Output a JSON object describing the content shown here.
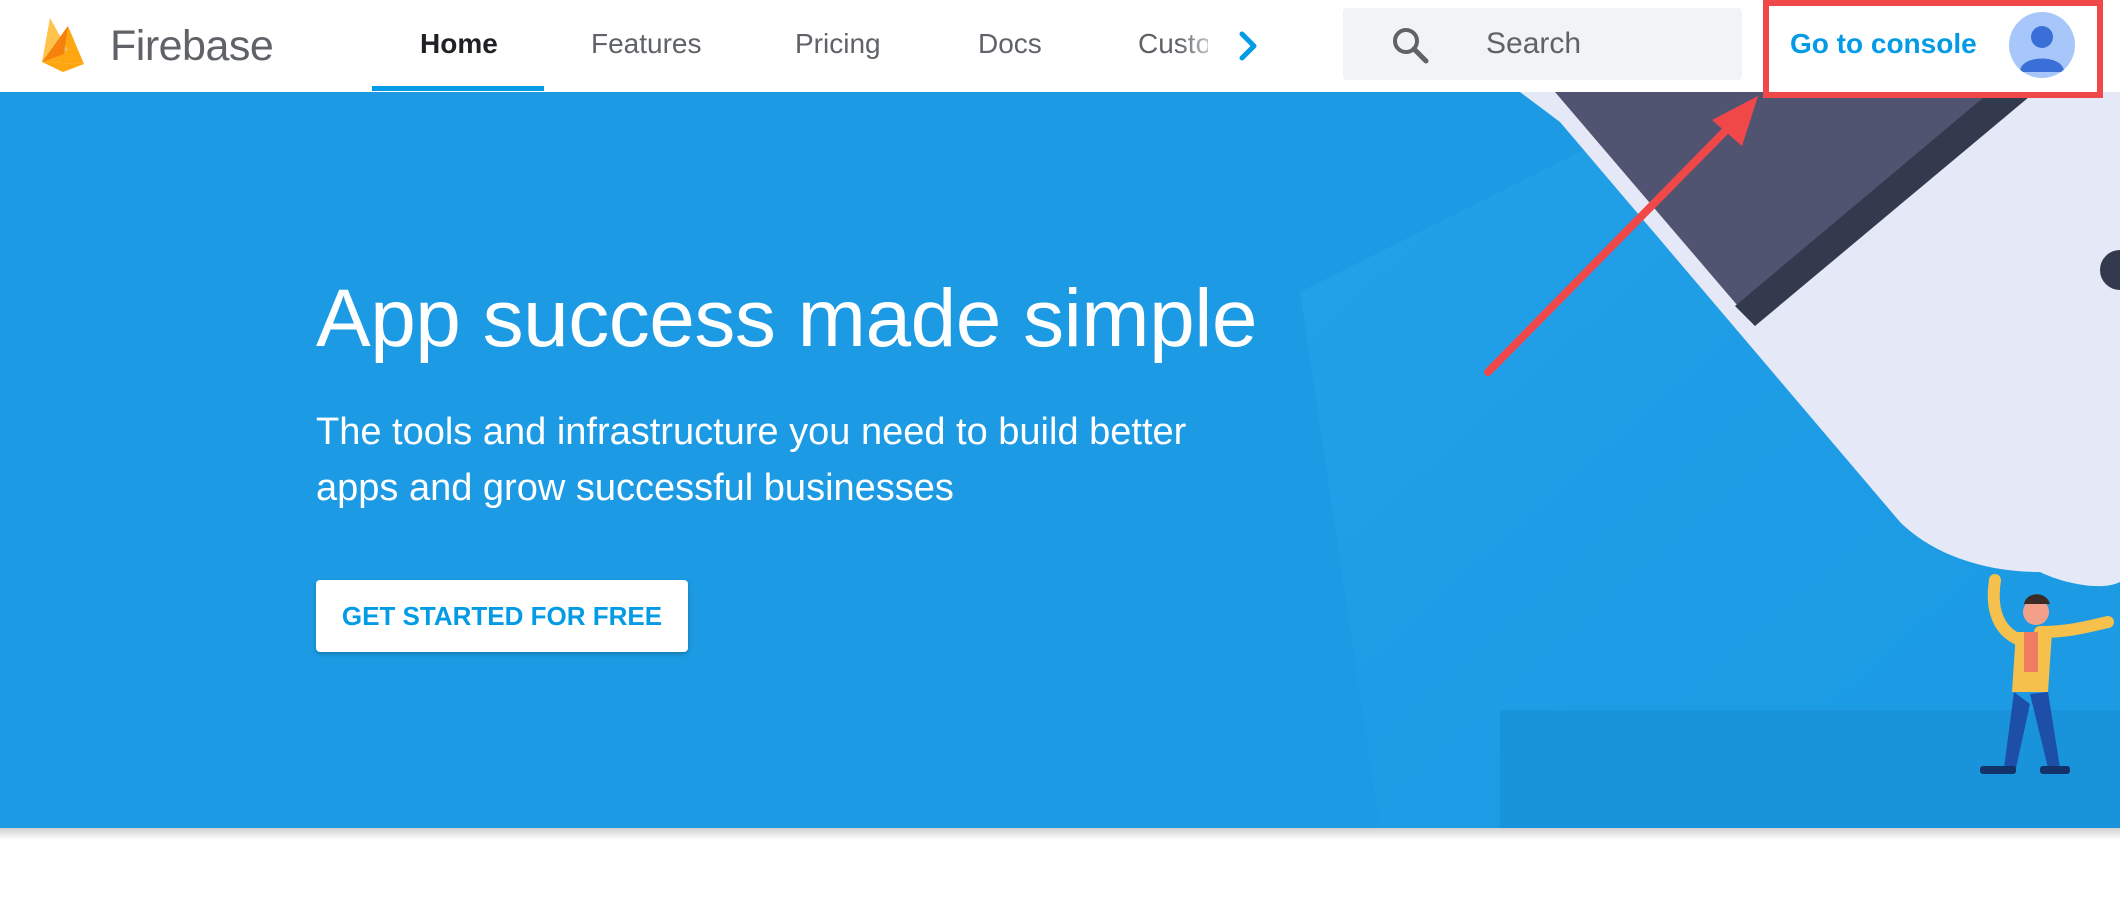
{
  "header": {
    "brand": "Firebase",
    "tabs": [
      {
        "label": "Home",
        "active": true
      },
      {
        "label": "Features",
        "active": false
      },
      {
        "label": "Pricing",
        "active": false
      },
      {
        "label": "Docs",
        "active": false
      },
      {
        "label": "Customers",
        "active": false
      }
    ],
    "search": {
      "placeholder": "Search"
    },
    "console_link": "Go to console",
    "icons": {
      "search": "search-icon",
      "more_tabs": "chevron-right-icon",
      "account": "avatar"
    }
  },
  "hero": {
    "headline": "App success made simple",
    "subline": "The tools and infrastructure you need to build better apps and grow successful businesses",
    "cta_label": "GET STARTED FOR FREE"
  },
  "colors": {
    "accent": "#039be5",
    "hero_background": "#1c9be4",
    "annotation": "#f04848",
    "avatar": "#a7c7fa"
  }
}
